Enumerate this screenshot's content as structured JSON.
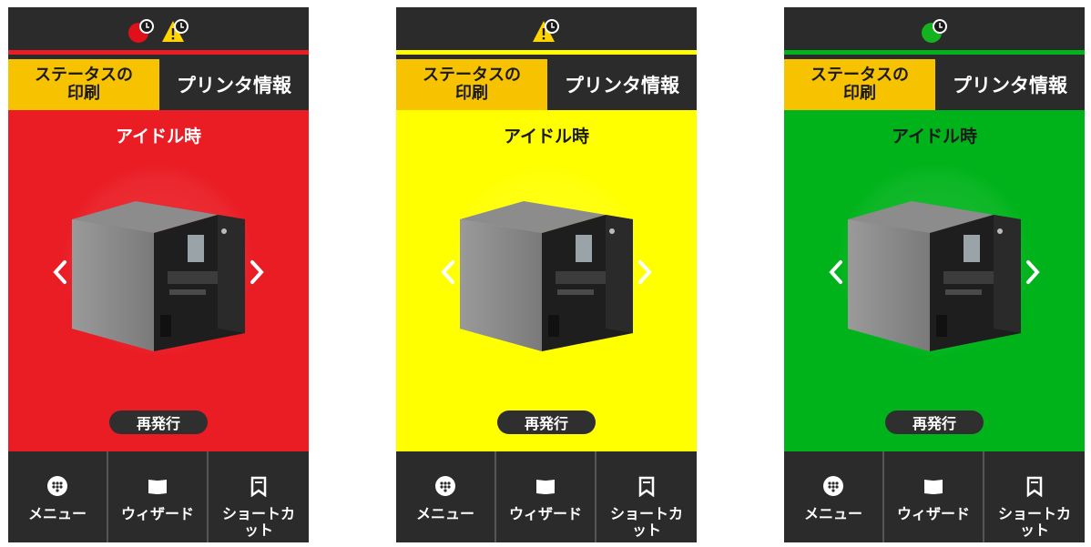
{
  "tabs": {
    "print_status": "ステータスの\n印刷",
    "printer_info": "プリンタ情報"
  },
  "main": {
    "status_title": "アイドル時",
    "reprint_label": "再発行"
  },
  "nav": {
    "menu": "メニュー",
    "wizard": "ウィザード",
    "shortcut": "ショートカ\nット"
  },
  "screens": [
    {
      "name": "error",
      "background": "#ea1c24",
      "accent": "#ea1c24",
      "status_icons": [
        "error-alert-icon",
        "warning-alert-icon"
      ]
    },
    {
      "name": "warning",
      "background": "#ffff00",
      "accent": "#ffff00",
      "status_icons": [
        "warning-alert-icon"
      ]
    },
    {
      "name": "ready",
      "background": "#00b31b",
      "accent": "#00b31b",
      "status_icons": [
        "ready-alert-icon"
      ]
    }
  ],
  "icons": {
    "menu": "menu-dots-icon",
    "wizard": "book-icon",
    "shortcut": "bookmark-icon",
    "previous": "chevron-left-icon",
    "next": "chevron-right-icon"
  }
}
